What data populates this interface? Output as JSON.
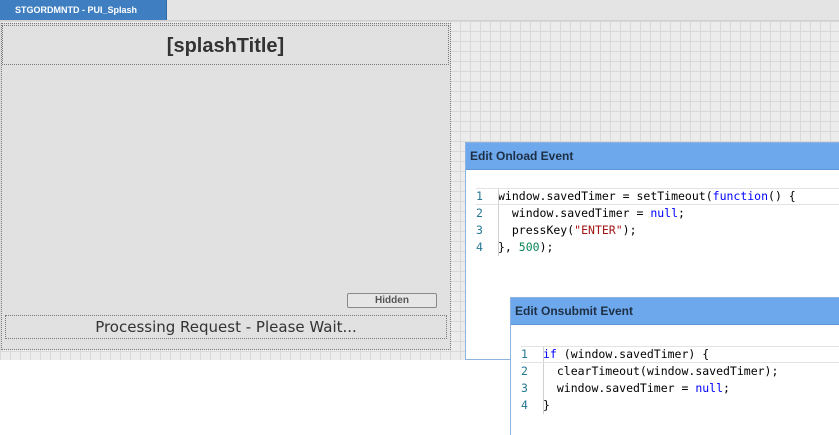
{
  "tab": {
    "label": "STGORDMNTD - PUI_Splash"
  },
  "splash": {
    "title": "[splashTitle]",
    "hidden_button_label": "Hidden",
    "processing_text": "Processing Request - Please Wait..."
  },
  "onload_dialog": {
    "title": "Edit Onload Event",
    "lines": [
      {
        "num": "1",
        "parts": [
          {
            "t": "window.savedTimer = setTimeout("
          },
          {
            "t": "function",
            "c": "kw"
          },
          {
            "t": "() {"
          }
        ]
      },
      {
        "num": "2",
        "parts": [
          {
            "t": "  window.savedTimer = "
          },
          {
            "t": "null",
            "c": "kw"
          },
          {
            "t": ";"
          }
        ]
      },
      {
        "num": "3",
        "parts": [
          {
            "t": "  pressKey("
          },
          {
            "t": "\"ENTER\"",
            "c": "str"
          },
          {
            "t": ");"
          }
        ]
      },
      {
        "num": "4",
        "parts": [
          {
            "t": "}, "
          },
          {
            "t": "500",
            "c": "num"
          },
          {
            "t": ");"
          }
        ]
      }
    ]
  },
  "onsubmit_dialog": {
    "title": "Edit Onsubmit Event",
    "lines": [
      {
        "num": "1",
        "parts": [
          {
            "t": "if",
            "c": "kw"
          },
          {
            "t": " (window.savedTimer) {"
          }
        ]
      },
      {
        "num": "2",
        "parts": [
          {
            "t": "  clearTimeout(window.savedTimer);"
          }
        ]
      },
      {
        "num": "3",
        "parts": [
          {
            "t": "  window.savedTimer = "
          },
          {
            "t": "null",
            "c": "kw"
          },
          {
            "t": ";"
          }
        ]
      },
      {
        "num": "4",
        "parts": [
          {
            "t": "}"
          }
        ]
      }
    ]
  },
  "colors": {
    "tab_blue": "#3f7fc1",
    "dialog_header": "#6ea8ec",
    "keyword": "#0000ff",
    "string": "#a31515",
    "number": "#098658",
    "line_number": "#237893"
  }
}
